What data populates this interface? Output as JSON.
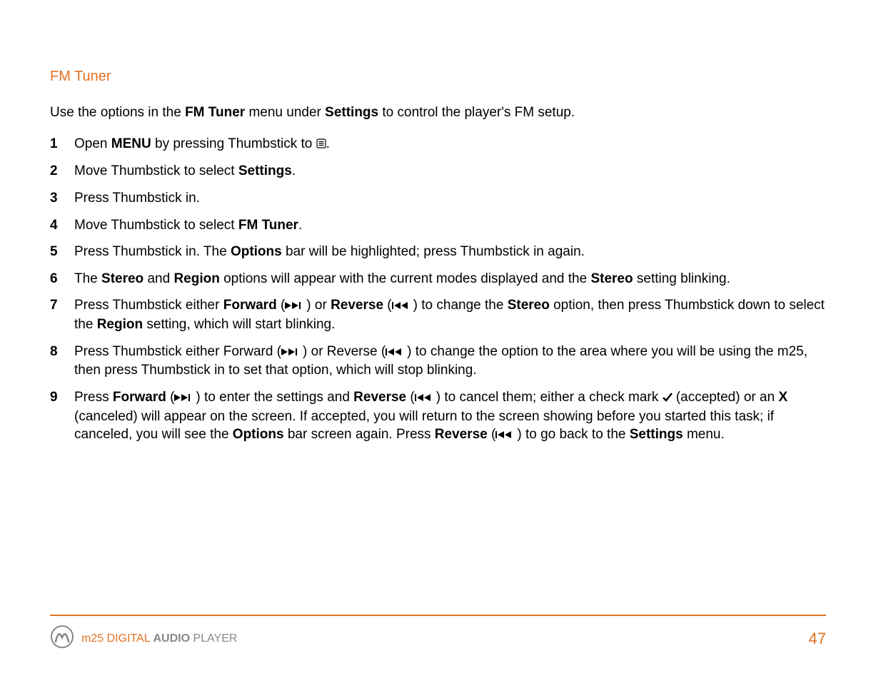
{
  "heading": "FM Tuner",
  "intro": {
    "pre": "Use the options in the ",
    "b1": "FM Tuner",
    "mid": " menu under ",
    "b2": "Settings",
    "post": " to control the player's FM setup."
  },
  "steps": {
    "s1": {
      "pre": "Open ",
      "b": "MENU",
      "post_a": " by pressing Thumbstick to ",
      "post_b": "."
    },
    "s2": {
      "pre": "Move Thumbstick to select ",
      "b": "Settings",
      "post": "."
    },
    "s3": {
      "text": "Press Thumbstick in."
    },
    "s4": {
      "pre": "Move Thumbstick to select ",
      "b": "FM Tuner",
      "post": "."
    },
    "s5": {
      "pre": "Press Thumbstick in. The ",
      "b": "Options",
      "post": " bar will be highlighted; press Thumbstick in again."
    },
    "s6": {
      "p1": "The ",
      "b1": "Stereo",
      "p2": " and ",
      "b2": "Region",
      "p3": " options will appear with the current modes displayed and the ",
      "b3": "Stereo",
      "p4": " setting blinking."
    },
    "s7": {
      "p1": "Press Thumbstick either ",
      "b1": "Forward",
      "p2": " (",
      "p3": ") or ",
      "b2": "Reverse",
      "p4": " (",
      "p5": ") to change the ",
      "b3": "Stereo",
      "p6": " option, then press Thumbstick down to select the ",
      "b4": "Region",
      "p7": " setting, which will start blinking."
    },
    "s8": {
      "p1": "Press Thumbstick either Forward (",
      "p2": ") or Reverse (",
      "p3": ") to change the option to the area where you will be using the m25, then press Thumbstick in to set that option, which will stop blinking."
    },
    "s9": {
      "p1": "Press ",
      "b1": "Forward",
      "p2": " (",
      "p3": ") to enter the settings and ",
      "b2": "Reverse",
      "p4": " (",
      "p5": ") to cancel them; either a check mark ",
      "p6": " (accepted) or an ",
      "b3": "X",
      "p7": " (canceled) will appear on the screen. If accepted, you will return to the screen showing before you started this task; if canceled, you will see the ",
      "b4": "Options",
      "p8": " bar screen again. Press ",
      "b5": "Reverse",
      "p9": " (",
      "p10": ") to go back to the ",
      "b6": "Settings",
      "p11": " menu."
    }
  },
  "footer": {
    "prefix": "m25 DIGITAL ",
    "bold": "AUDIO",
    "suffix": " PLAYER",
    "page": "47"
  }
}
